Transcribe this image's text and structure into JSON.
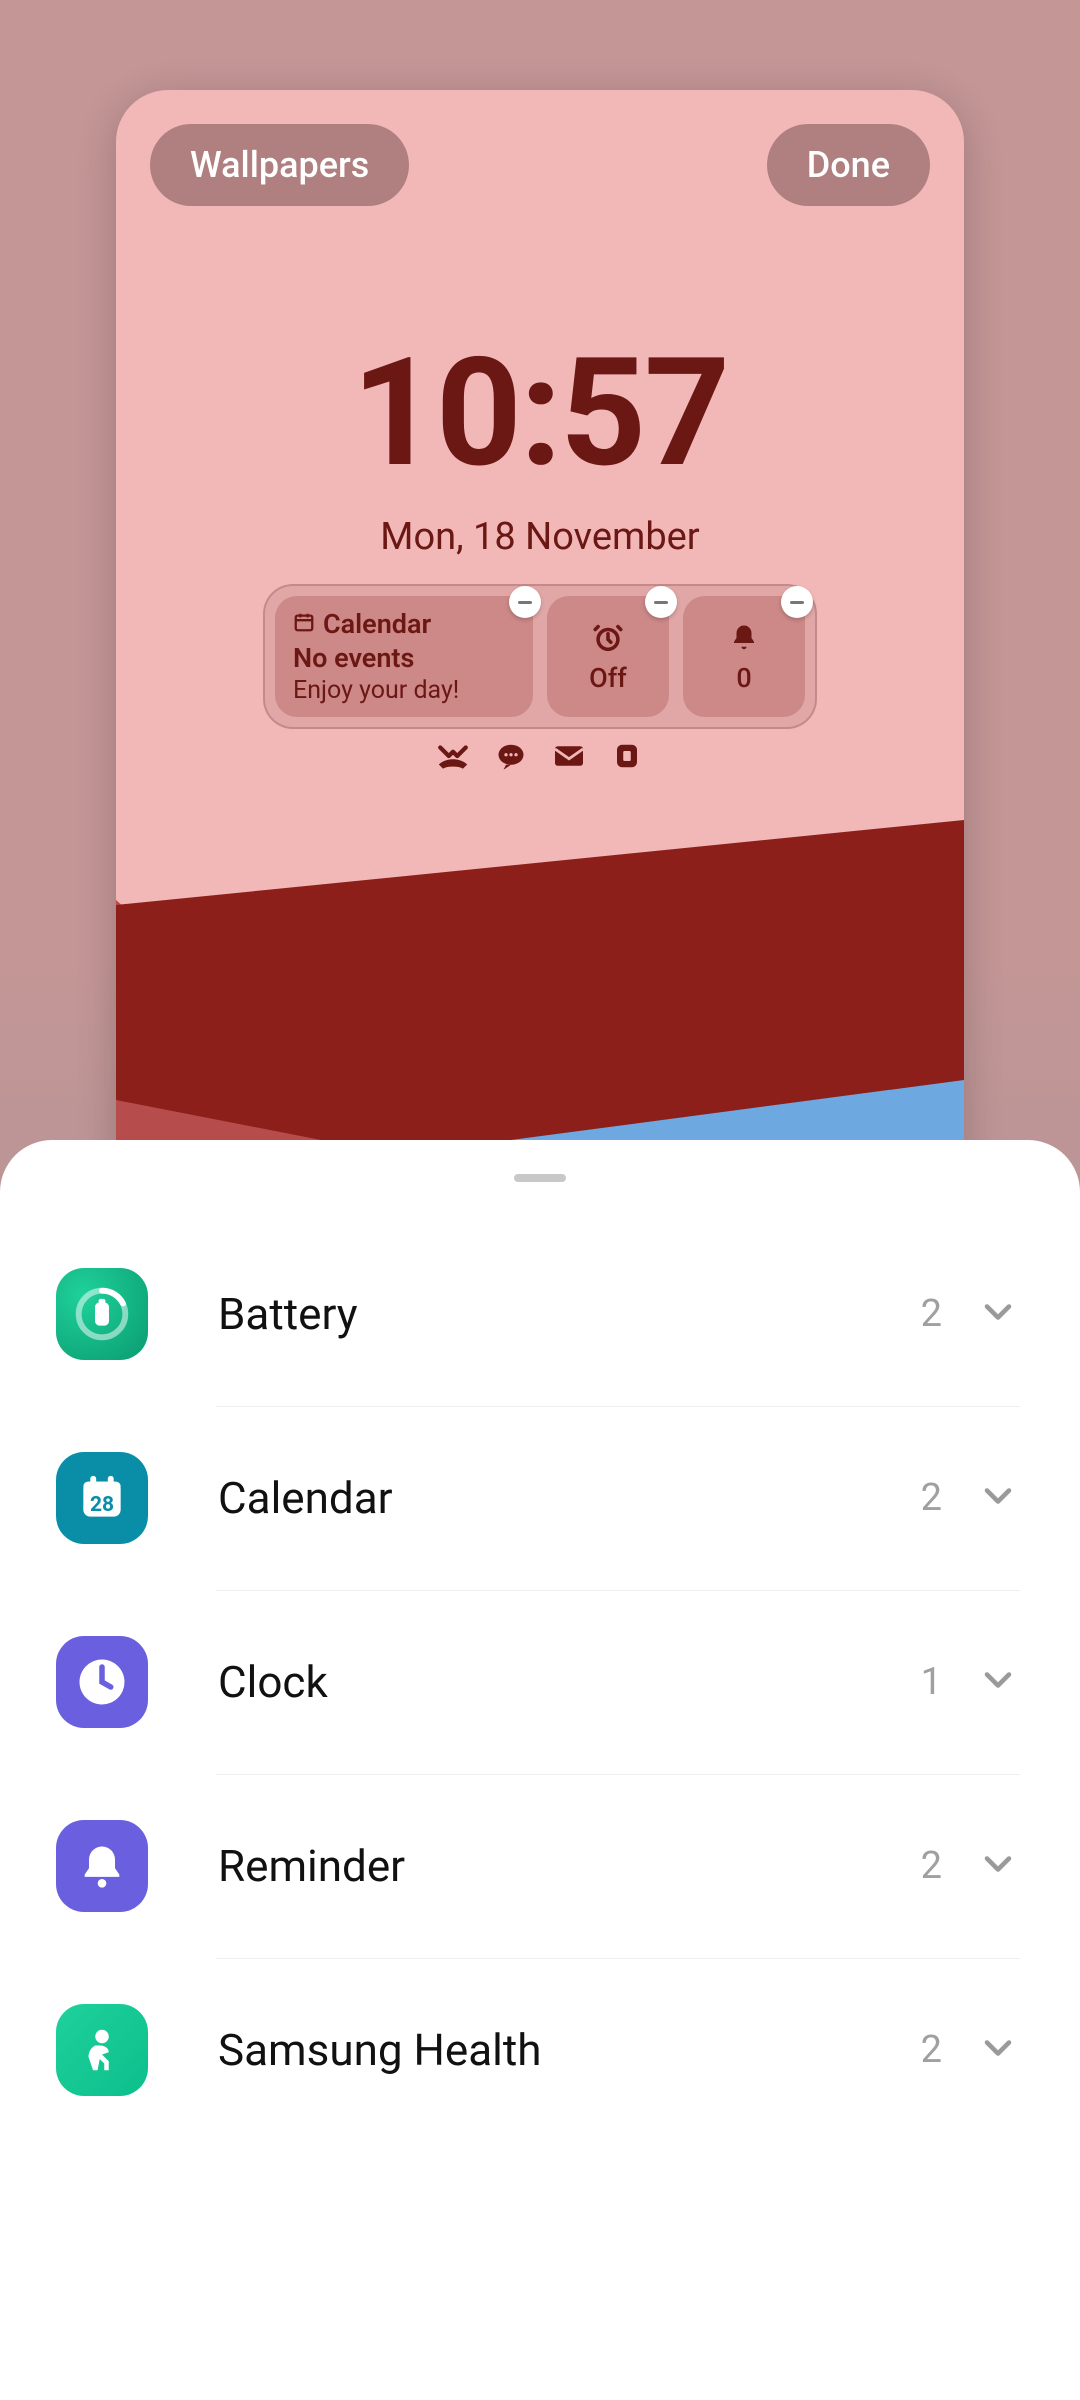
{
  "preview": {
    "wallpapers_btn": "Wallpapers",
    "done_btn": "Done",
    "clock": {
      "time": "10:57",
      "date": "Mon, 18 November"
    },
    "widgets": {
      "calendar": {
        "title": "Calendar",
        "line1": "No events",
        "line2": "Enjoy your day!"
      },
      "alarm": {
        "icon": "alarm-clock-icon",
        "label": "Off"
      },
      "notifications": {
        "icon": "bell-icon",
        "label": "0"
      }
    },
    "notif_icons": [
      "missed-call-icon",
      "message-bubble-icon",
      "mail-icon",
      "app-update-icon"
    ]
  },
  "sheet": {
    "items": [
      {
        "name": "Battery",
        "count": "2",
        "icon": "battery-app-icon",
        "icon_class": "ic-battery"
      },
      {
        "name": "Calendar",
        "count": "2",
        "icon": "calendar-app-icon",
        "icon_class": "ic-calendar"
      },
      {
        "name": "Clock",
        "count": "1",
        "icon": "clock-app-icon",
        "icon_class": "ic-clock"
      },
      {
        "name": "Reminder",
        "count": "2",
        "icon": "reminder-app-icon",
        "icon_class": "ic-reminder"
      },
      {
        "name": "Samsung Health",
        "count": "2",
        "icon": "health-app-icon",
        "icon_class": "ic-health"
      }
    ]
  }
}
